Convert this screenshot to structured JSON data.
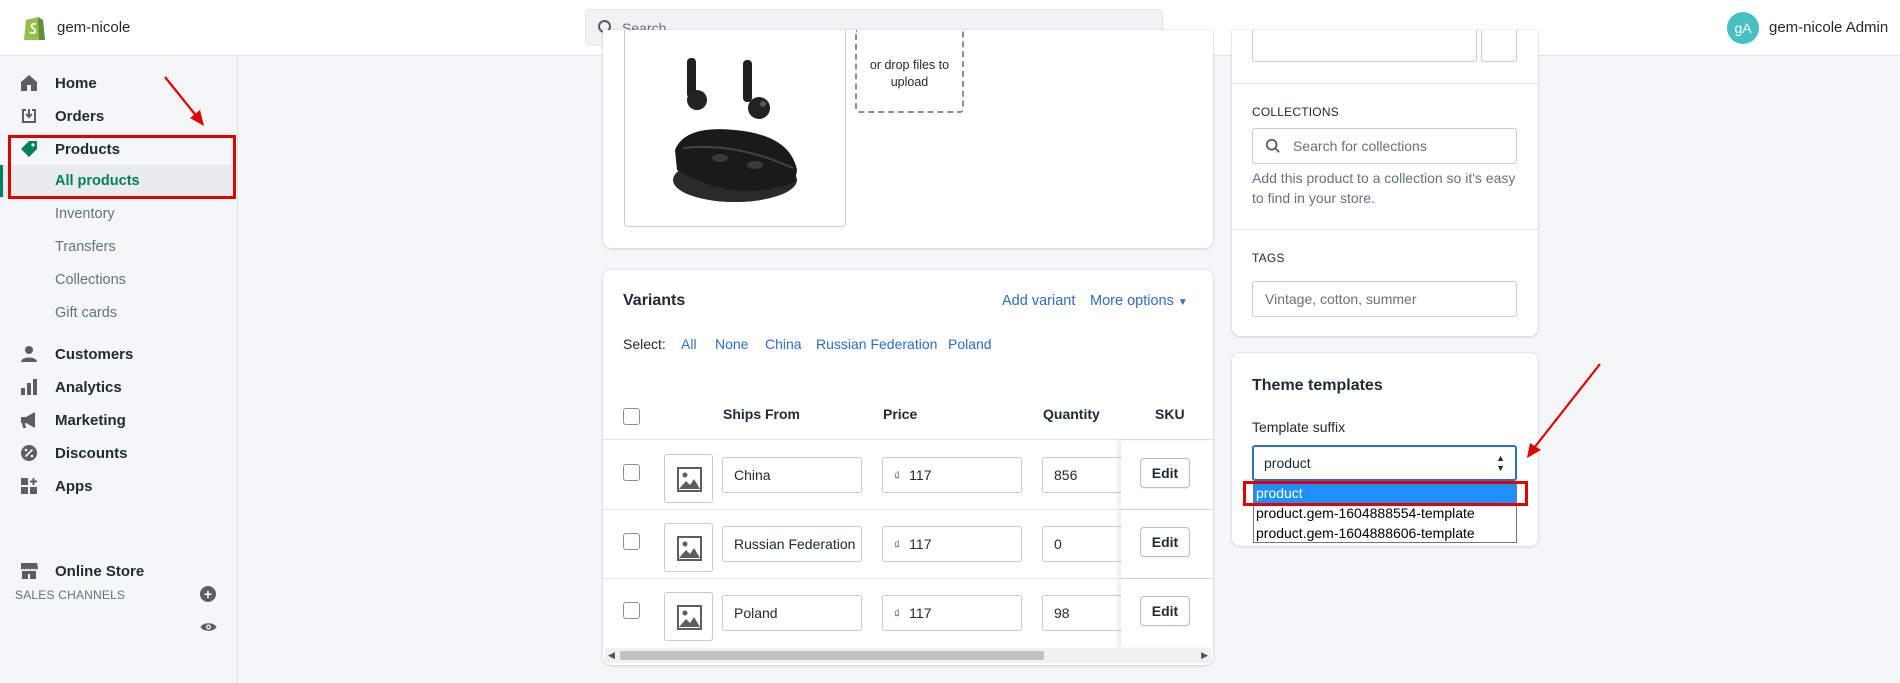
{
  "topbar": {
    "shop_name": "gem-nicole",
    "search_placeholder": "Search",
    "avatar_initials": "gA",
    "user_name": "gem-nicole Admin"
  },
  "sidebar": {
    "items": [
      {
        "label": "Home",
        "icon": "home-icon"
      },
      {
        "label": "Orders",
        "icon": "orders-icon"
      },
      {
        "label": "Products",
        "icon": "tag-icon"
      }
    ],
    "product_sub": [
      "All products",
      "Inventory",
      "Transfers",
      "Collections",
      "Gift cards"
    ],
    "items2": [
      {
        "label": "Customers",
        "icon": "person-icon"
      },
      {
        "label": "Analytics",
        "icon": "bar-chart-icon"
      },
      {
        "label": "Marketing",
        "icon": "megaphone-icon"
      },
      {
        "label": "Discounts",
        "icon": "discount-icon"
      },
      {
        "label": "Apps",
        "icon": "apps-icon"
      }
    ],
    "sales_channels_label": "SALES CHANNELS",
    "online_store": "Online Store"
  },
  "media": {
    "drop_text": "or drop files to upload"
  },
  "variants": {
    "title": "Variants",
    "add_variant": "Add variant",
    "more_options": "More options",
    "select_label": "Select:",
    "select_links": [
      "All",
      "None",
      "China",
      "Russian Federation",
      "Poland"
    ],
    "headers": {
      "ships_from": "Ships From",
      "price": "Price",
      "quantity": "Quantity",
      "sku": "SKU"
    },
    "currency_symbol": "₫",
    "edit_label": "Edit",
    "rows": [
      {
        "ships_from": "China",
        "price": "117",
        "quantity": "856"
      },
      {
        "ships_from": "Russian Federation",
        "price": "117",
        "quantity": "0"
      },
      {
        "ships_from": "Poland",
        "price": "117",
        "quantity": "98"
      }
    ]
  },
  "organization": {
    "collections_label": "COLLECTIONS",
    "collections_placeholder": "Search for collections",
    "collections_help": "Add this product to a collection so it's easy to find in your store.",
    "tags_label": "TAGS",
    "tags_placeholder": "Vintage, cotton, summer"
  },
  "theme": {
    "title": "Theme templates",
    "suffix_label": "Template suffix",
    "selected": "product",
    "options": [
      "product",
      "product.gem-1604888554-template",
      "product.gem-1604888606-template"
    ]
  },
  "colors": {
    "accent_green": "#008060",
    "link_blue": "#2c6ecb",
    "annotation_red": "#e00000",
    "highlight_blue": "#1e90ff"
  }
}
